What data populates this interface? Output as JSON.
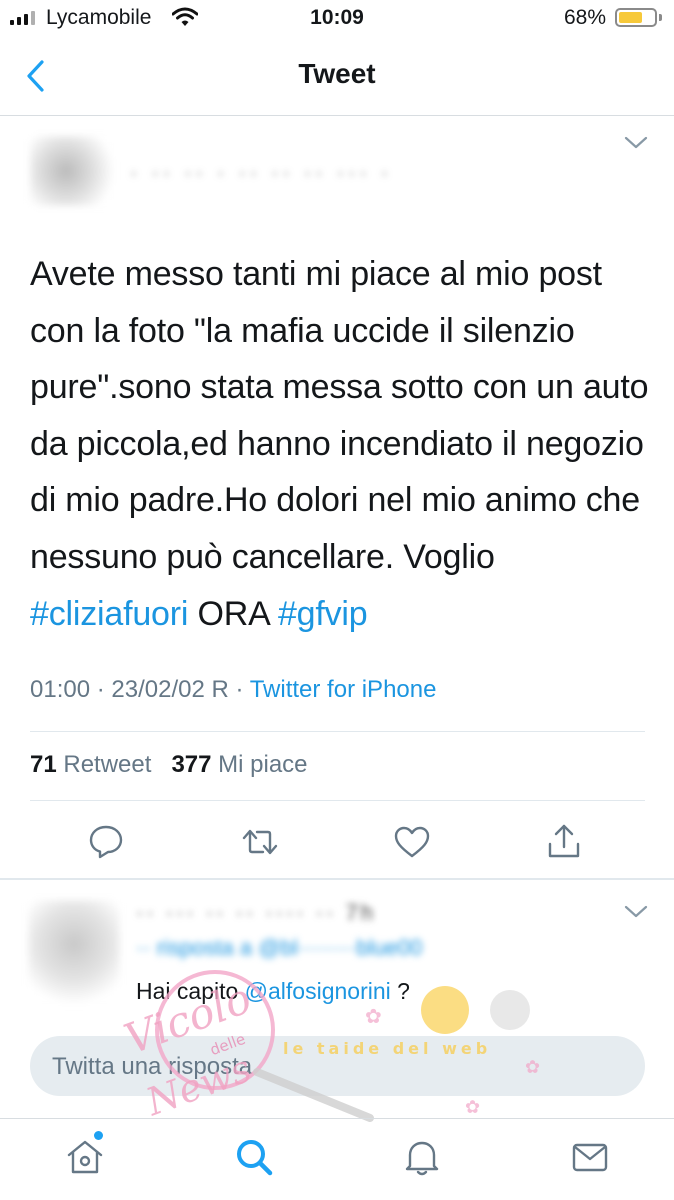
{
  "status_bar": {
    "carrier": "Lycamobile",
    "time": "10:09",
    "battery_percent": "68%",
    "battery_level": 0.68,
    "battery_color": "#f7c93a"
  },
  "nav": {
    "title": "Tweet",
    "back_icon": "chevron-left-icon"
  },
  "tweet": {
    "author_blurred": "· ·· ·· · ·· ·· ·· ··· ·",
    "text": [
      {
        "t": "Avete messo tanti mi piace al mio post con la foto \"la mafia uccide il silenzio pure\".sono stata messa sotto con un auto da piccola,ed hanno incendiato il negozio di mio padre.Ho dolori nel mio animo che nessuno può cancellare. Voglio "
      },
      {
        "h": "#cliziafuori"
      },
      {
        "t": " ORA  "
      },
      {
        "h": "#gfvip"
      }
    ],
    "timestamp": "01:00 · 23/02/02 R · ",
    "source": "Twitter for iPhone",
    "retweets_count": "71",
    "retweets_label": "Retweet",
    "likes_count": "377",
    "likes_label": "Mi piace",
    "accent_color": "#1b95e0"
  },
  "reply": {
    "header_blurred": "·· ··· ·· ·· ···· ·· 7h",
    "replying_blurred": "·· risposta a @bl········blue00",
    "text_prefix": "Hai capito ",
    "mention": "@alfosignorini",
    "text_suffix": " ?"
  },
  "compose": {
    "placeholder": "Twitta una risposta"
  },
  "tab_bar": {
    "items": [
      "home-icon",
      "search-icon",
      "notifications-icon",
      "messages-icon"
    ],
    "active": "search-icon",
    "active_color": "#1da1f2"
  },
  "watermark": {
    "line1": "Vicolo",
    "line2": "delle",
    "line3": "News",
    "banner": "le taide del web"
  }
}
